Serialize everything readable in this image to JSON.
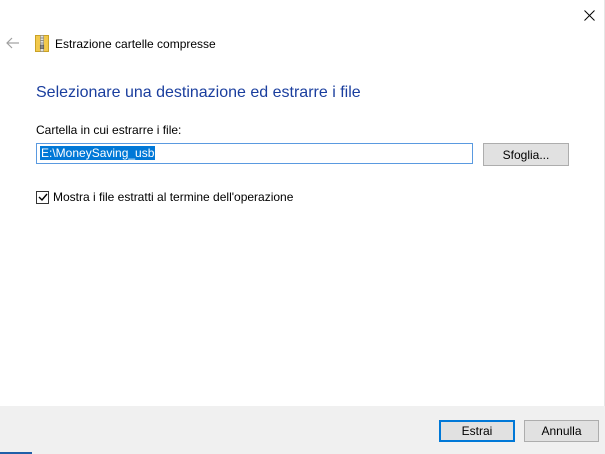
{
  "window": {
    "title": "Estrazione cartelle compresse"
  },
  "main": {
    "heading": "Selezionare una destinazione ed estrarre i file",
    "destination_label": "Cartella in cui estrarre i file:",
    "destination_value": "E:\\MoneySaving_usb",
    "browse_label": "Sfoglia...",
    "show_files_label": "Mostra i file estratti al termine dell'operazione",
    "show_files_checked": true
  },
  "footer": {
    "extract_label": "Estrai",
    "cancel_label": "Annulla"
  },
  "icons": {
    "close": "close-icon",
    "back": "back-arrow-icon",
    "title": "zip-folder-icon",
    "check": "checkmark-icon"
  },
  "colors": {
    "heading": "#1a3e9e",
    "accent": "#0078d7",
    "footer_bg": "#f0f0f0",
    "button_bg": "#e1e1e1"
  }
}
